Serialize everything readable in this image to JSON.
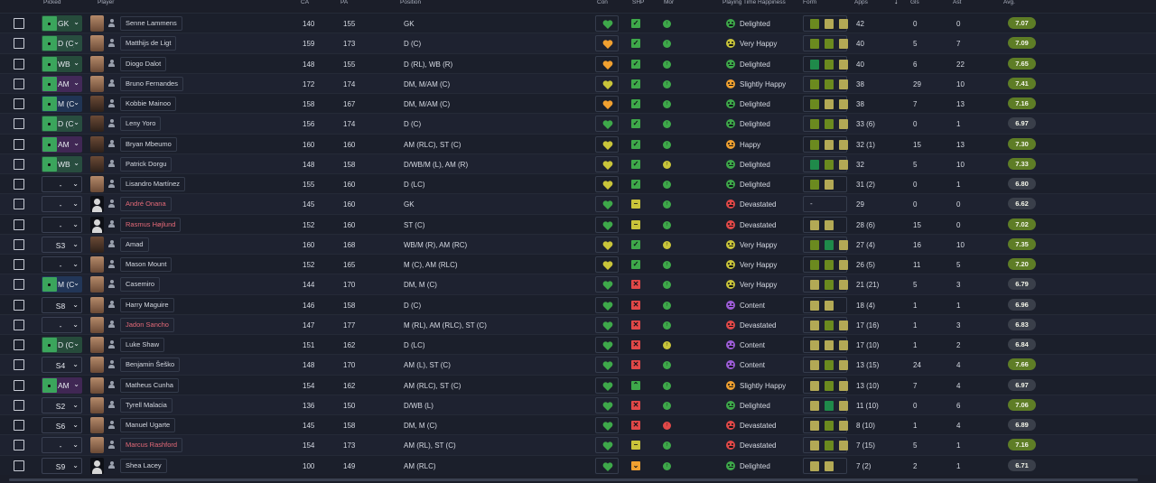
{
  "columns": {
    "picked": "Picked",
    "player": "Player",
    "ca": "CA",
    "pa": "PA",
    "position": "Position",
    "con": "Con",
    "shp": "SHP",
    "mor": "Mor",
    "playing_time": "Playing Time Happiness",
    "form": "Form",
    "apps": "Apps",
    "gls": "Gls",
    "ast": "Ast",
    "avg": "Avg."
  },
  "colors": {
    "bg": "#1b1e29",
    "green": "#3ea84a",
    "yellow": "#c9c43a",
    "orange": "#f0a030",
    "red": "#e14848",
    "purple": "#9c5cd6",
    "avg_green": "#5e7d26",
    "avg_grey": "#3a3f4a"
  },
  "rows": [
    {
      "pick": "GK",
      "pick_type": "pos",
      "pick_color": "#3ba55c",
      "face": "light",
      "name": "Senne Lammens",
      "ca": "140",
      "pa": "155",
      "position": "GK",
      "con": "green",
      "shp": "check",
      "shp_c": "green",
      "mor": "green",
      "hap": "Delighted",
      "hap_c": "green",
      "form": [
        "#6b8a1f",
        "#b3a955",
        "#b3a955"
      ],
      "apps": "42",
      "gls": "0",
      "ast": "0",
      "avg": "7.07",
      "avg_c": "green"
    },
    {
      "pick": "D (C)",
      "pick_type": "pos",
      "pick_color": "#3ba55c",
      "face": "light",
      "name": "Matthijs de Ligt",
      "ca": "159",
      "pa": "173",
      "position": "D (C)",
      "con": "orange",
      "shp": "check",
      "shp_c": "green",
      "mor": "green",
      "hap": "Very Happy",
      "hap_c": "yellow",
      "form": [
        "#6b8a1f",
        "#6b8a1f",
        "#b3a955"
      ],
      "apps": "40",
      "gls": "5",
      "ast": "7",
      "avg": "7.09",
      "avg_c": "green"
    },
    {
      "pick": "WB",
      "pick_type": "pos",
      "pick_color": "#3ba55c",
      "face": "light",
      "name": "Diogo Dalot",
      "ca": "148",
      "pa": "155",
      "position": "D (RL), WB (R)",
      "con": "orange",
      "shp": "check",
      "shp_c": "green",
      "mor": "green",
      "hap": "Delighted",
      "hap_c": "green",
      "form": [
        "#1f8a4a",
        "#6b8a1f",
        "#b3a955"
      ],
      "apps": "40",
      "gls": "6",
      "ast": "22",
      "avg": "7.65",
      "avg_c": "green"
    },
    {
      "pick": "AM",
      "pick_type": "pos",
      "pick_color": "#8a3aa8",
      "face": "light",
      "name": "Bruno Fernandes",
      "ca": "172",
      "pa": "174",
      "position": "DM, M/AM (C)",
      "con": "yellow",
      "shp": "check",
      "shp_c": "green",
      "mor": "green",
      "hap": "Slightly Happy",
      "hap_c": "orange",
      "form": [
        "#6b8a1f",
        "#6b8a1f",
        "#b3a955"
      ],
      "apps": "38",
      "gls": "29",
      "ast": "10",
      "avg": "7.41",
      "avg_c": "green"
    },
    {
      "pick": "M (C)",
      "pick_type": "pos",
      "pick_color": "#2a5fa8",
      "face": "dark",
      "name": "Kobbie Mainoo",
      "ca": "158",
      "pa": "167",
      "position": "DM, M/AM (C)",
      "con": "orange",
      "shp": "check",
      "shp_c": "green",
      "mor": "green",
      "hap": "Delighted",
      "hap_c": "green",
      "form": [
        "#6b8a1f",
        "#b3a955",
        "#b3a955"
      ],
      "apps": "38",
      "gls": "7",
      "ast": "13",
      "avg": "7.16",
      "avg_c": "green"
    },
    {
      "pick": "D (C)",
      "pick_type": "pos",
      "pick_color": "#3ba55c",
      "face": "dark",
      "name": "Leny Yoro",
      "ca": "156",
      "pa": "174",
      "position": "D (C)",
      "con": "green",
      "shp": "check",
      "shp_c": "green",
      "mor": "green",
      "hap": "Delighted",
      "hap_c": "green",
      "form": [
        "#6b8a1f",
        "#6b8a1f",
        "#b3a955"
      ],
      "apps": "33 (6)",
      "gls": "0",
      "ast": "1",
      "avg": "6.97",
      "avg_c": "grey"
    },
    {
      "pick": "AM",
      "pick_type": "pos",
      "pick_color": "#8a3aa8",
      "face": "dark",
      "name": "Bryan Mbeumo",
      "ca": "160",
      "pa": "160",
      "position": "AM (RLC), ST (C)",
      "con": "yellow",
      "shp": "check",
      "shp_c": "green",
      "mor": "green",
      "hap": "Happy",
      "hap_c": "orange",
      "form": [
        "#6b8a1f",
        "#b3a955",
        "#b3a955"
      ],
      "apps": "32 (1)",
      "gls": "15",
      "ast": "13",
      "avg": "7.30",
      "avg_c": "green"
    },
    {
      "pick": "WB",
      "pick_type": "pos",
      "pick_color": "#3ba55c",
      "face": "dark",
      "name": "Patrick Dorgu",
      "ca": "148",
      "pa": "158",
      "position": "D/WB/M (L), AM (R)",
      "con": "yellow",
      "shp": "check",
      "shp_c": "green",
      "mor": "yellow",
      "hap": "Delighted",
      "hap_c": "green",
      "form": [
        "#1f8a4a",
        "#6b8a1f",
        "#b3a955"
      ],
      "apps": "32",
      "gls": "5",
      "ast": "10",
      "avg": "7.33",
      "avg_c": "green"
    },
    {
      "pick": "-",
      "pick_type": "dash",
      "face": "light",
      "name": "Lisandro Martínez",
      "ca": "155",
      "pa": "160",
      "position": "D (LC)",
      "con": "yellow",
      "shp": "check",
      "shp_c": "green",
      "mor": "green",
      "hap": "Delighted",
      "hap_c": "green",
      "form": [
        "#6b8a1f",
        "#b3a955"
      ],
      "apps": "31 (2)",
      "gls": "0",
      "ast": "1",
      "avg": "6.80",
      "avg_c": "grey"
    },
    {
      "pick": "-",
      "pick_type": "dash",
      "face": "sil",
      "name": "André Onana",
      "name_red": true,
      "ca": "145",
      "pa": "160",
      "position": "GK",
      "con": "green",
      "shp": "minus",
      "shp_c": "yellow",
      "mor": "green",
      "hap": "Devastated",
      "hap_c": "red",
      "form": [],
      "form_dash": "-",
      "apps": "29",
      "gls": "0",
      "ast": "0",
      "avg": "6.62",
      "avg_c": "grey"
    },
    {
      "pick": "-",
      "pick_type": "dash",
      "face": "sil",
      "name": "Rasmus Højlund",
      "name_red": true,
      "ca": "152",
      "pa": "160",
      "position": "ST (C)",
      "con": "green",
      "shp": "minus",
      "shp_c": "yellow",
      "mor": "green",
      "hap": "Devastated",
      "hap_c": "red",
      "form": [
        "#b3a955",
        "#b3a955"
      ],
      "apps": "28 (6)",
      "gls": "15",
      "ast": "0",
      "avg": "7.02",
      "avg_c": "green"
    },
    {
      "pick": "S3",
      "pick_type": "sub",
      "face": "dark",
      "name": "Amad",
      "ca": "160",
      "pa": "168",
      "position": "WB/M (R), AM (RC)",
      "con": "yellow",
      "shp": "check",
      "shp_c": "green",
      "mor": "yellow",
      "hap": "Very Happy",
      "hap_c": "yellow",
      "form": [
        "#6b8a1f",
        "#1f8a4a",
        "#b3a955"
      ],
      "apps": "27 (4)",
      "gls": "16",
      "ast": "10",
      "avg": "7.35",
      "avg_c": "green"
    },
    {
      "pick": "-",
      "pick_type": "dash",
      "face": "light",
      "name": "Mason Mount",
      "ca": "152",
      "pa": "165",
      "position": "M (C), AM (RLC)",
      "con": "yellow",
      "shp": "check",
      "shp_c": "green",
      "mor": "green",
      "hap": "Very Happy",
      "hap_c": "yellow",
      "form": [
        "#6b8a1f",
        "#6b8a1f",
        "#b3a955"
      ],
      "apps": "26 (5)",
      "gls": "11",
      "ast": "5",
      "avg": "7.20",
      "avg_c": "green"
    },
    {
      "pick": "M (C)",
      "pick_type": "pos",
      "pick_color": "#2a5fa8",
      "face": "light",
      "name": "Casemiro",
      "ca": "144",
      "pa": "170",
      "position": "DM, M (C)",
      "con": "green",
      "shp": "x",
      "shp_c": "red",
      "mor": "green",
      "hap": "Very Happy",
      "hap_c": "yellow",
      "form": [
        "#b3a955",
        "#6b8a1f",
        "#b3a955"
      ],
      "apps": "21 (21)",
      "gls": "5",
      "ast": "3",
      "avg": "6.79",
      "avg_c": "grey"
    },
    {
      "pick": "S8",
      "pick_type": "sub",
      "face": "light",
      "name": "Harry Maguire",
      "ca": "146",
      "pa": "158",
      "position": "D (C)",
      "con": "green",
      "shp": "x",
      "shp_c": "red",
      "mor": "green",
      "hap": "Content",
      "hap_c": "purple",
      "form": [
        "#b3a955",
        "#b3a955"
      ],
      "apps": "18 (4)",
      "gls": "1",
      "ast": "1",
      "avg": "6.96",
      "avg_c": "grey"
    },
    {
      "pick": "-",
      "pick_type": "dash",
      "face": "light",
      "name": "Jadon Sancho",
      "name_red": true,
      "ca": "147",
      "pa": "177",
      "position": "M (RL), AM (RLC), ST (C)",
      "con": "green",
      "shp": "x",
      "shp_c": "red",
      "mor": "green",
      "hap": "Devastated",
      "hap_c": "red",
      "form": [
        "#b3a955",
        "#6b8a1f",
        "#b3a955"
      ],
      "apps": "17 (16)",
      "gls": "1",
      "ast": "3",
      "avg": "6.83",
      "avg_c": "grey"
    },
    {
      "pick": "D (C)",
      "pick_type": "pos",
      "pick_color": "#3ba55c",
      "face": "light",
      "name": "Luke Shaw",
      "ca": "151",
      "pa": "162",
      "position": "D (LC)",
      "con": "green",
      "shp": "x",
      "shp_c": "red",
      "mor": "yellow",
      "hap": "Content",
      "hap_c": "purple",
      "form": [
        "#b3a955",
        "#b3a955",
        "#b3a955"
      ],
      "apps": "17 (10)",
      "gls": "1",
      "ast": "2",
      "avg": "6.84",
      "avg_c": "grey"
    },
    {
      "pick": "S4",
      "pick_type": "sub",
      "face": "light",
      "name": "Benjamin Šeško",
      "ca": "148",
      "pa": "170",
      "position": "AM (L), ST (C)",
      "con": "green",
      "shp": "x",
      "shp_c": "red",
      "mor": "green",
      "hap": "Content",
      "hap_c": "purple",
      "form": [
        "#b3a955",
        "#6b8a1f",
        "#b3a955"
      ],
      "apps": "13 (15)",
      "gls": "24",
      "ast": "4",
      "avg": "7.66",
      "avg_c": "green"
    },
    {
      "pick": "AM",
      "pick_type": "pos",
      "pick_color": "#8a3aa8",
      "face": "light",
      "name": "Matheus Cunha",
      "ca": "154",
      "pa": "162",
      "position": "AM (RLC), ST (C)",
      "con": "green",
      "shp": "up",
      "shp_c": "green",
      "mor": "green",
      "hap": "Slightly Happy",
      "hap_c": "orange",
      "form": [
        "#b3a955",
        "#6b8a1f",
        "#b3a955"
      ],
      "apps": "13 (10)",
      "gls": "7",
      "ast": "4",
      "avg": "6.97",
      "avg_c": "grey"
    },
    {
      "pick": "S2",
      "pick_type": "sub",
      "face": "light",
      "name": "Tyrell Malacia",
      "ca": "136",
      "pa": "150",
      "position": "D/WB (L)",
      "con": "green",
      "shp": "x",
      "shp_c": "red",
      "mor": "green",
      "hap": "Delighted",
      "hap_c": "green",
      "form": [
        "#b3a955",
        "#1f8a4a",
        "#b3a955"
      ],
      "apps": "11 (10)",
      "gls": "0",
      "ast": "6",
      "avg": "7.06",
      "avg_c": "green"
    },
    {
      "pick": "S6",
      "pick_type": "sub",
      "face": "light",
      "name": "Manuel Ugarte",
      "ca": "145",
      "pa": "158",
      "position": "DM, M (C)",
      "con": "green",
      "shp": "x",
      "shp_c": "red",
      "mor": "red",
      "hap": "Devastated",
      "hap_c": "red",
      "form": [
        "#b3a955",
        "#6b8a1f",
        "#b3a955"
      ],
      "apps": "8 (10)",
      "gls": "1",
      "ast": "4",
      "avg": "6.89",
      "avg_c": "grey"
    },
    {
      "pick": "-",
      "pick_type": "dash",
      "face": "light",
      "name": "Marcus Rashford",
      "name_red": true,
      "ca": "154",
      "pa": "173",
      "position": "AM (RL), ST (C)",
      "con": "green",
      "shp": "minus",
      "shp_c": "yellow",
      "mor": "green",
      "hap": "Devastated",
      "hap_c": "red",
      "form": [
        "#b3a955",
        "#6b8a1f",
        "#b3a955"
      ],
      "apps": "7 (15)",
      "gls": "5",
      "ast": "1",
      "avg": "7.16",
      "avg_c": "green"
    },
    {
      "pick": "S9",
      "pick_type": "sub",
      "face": "sil",
      "name": "Shea Lacey",
      "ca": "100",
      "pa": "149",
      "position": "AM (RLC)",
      "con": "green",
      "shp": "down",
      "shp_c": "orange",
      "mor": "green",
      "hap": "Delighted",
      "hap_c": "green",
      "form": [
        "#b3a955",
        "#b3a955"
      ],
      "apps": "7 (2)",
      "gls": "2",
      "ast": "1",
      "avg": "6.71",
      "avg_c": "grey"
    }
  ]
}
